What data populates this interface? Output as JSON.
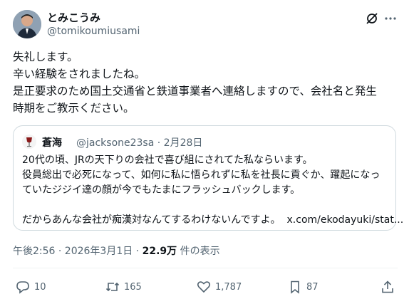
{
  "author": {
    "name": "とみこうみ",
    "handle": "@tomikoumiusami"
  },
  "post": {
    "lines": [
      "失礼します。",
      "辛い経験をされましたね。",
      "是正要求のため国土交通省と鉄道事業者へ連絡しますので、会社名と発生",
      "時期をご教示ください。"
    ]
  },
  "quote": {
    "name": "蒼海",
    "meta": "@jacksone23sa · 2月28日",
    "lines": [
      "20代の頃、JRの天下りの会社で喜び組にされてた私ならいます。",
      "役員総出で必死になって、如何に私に悟られずに私を社長に貢ぐか、躍起になっ",
      "ていたジジイ達の顔が今でもたまにフラッシュバックします。",
      "",
      "だからあんな会社が痴漢対なんてするわけないんですよ。"
    ],
    "link": "x.com/ekodayuki/stat..."
  },
  "timestamp": "午後2:56 · 2026年3月1日 · ",
  "views_count": "22.9万",
  "views_label": " 件の表示",
  "actions": {
    "reply_count": "10",
    "retweet_count": "165",
    "like_count": "1,787",
    "bookmark_count": "87"
  },
  "icons": [
    "no-edit-icon",
    "more-icon",
    "reply-icon",
    "retweet-icon",
    "like-icon",
    "bookmark-icon",
    "share-icon"
  ]
}
